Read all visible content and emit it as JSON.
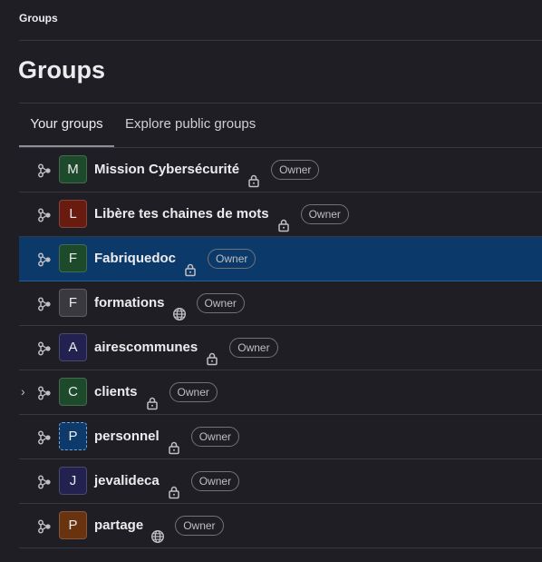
{
  "breadcrumb": "Groups",
  "page_title": "Groups",
  "tabs": [
    {
      "label": "Your groups",
      "active": true
    },
    {
      "label": "Explore public groups",
      "active": false
    }
  ],
  "groups": [
    {
      "initial": "M",
      "name": "Mission Cybersécurité",
      "visibility": "private",
      "role": "Owner",
      "avatar_color": "#1c4a2a",
      "expandable": false,
      "selected": false
    },
    {
      "initial": "L",
      "name": "Libère tes chaines de mots",
      "visibility": "private",
      "role": "Owner",
      "avatar_color": "#6a1b10",
      "expandable": false,
      "selected": false
    },
    {
      "initial": "F",
      "name": "Fabriquedoc",
      "visibility": "private",
      "role": "Owner",
      "avatar_color": "#1c4a2a",
      "expandable": false,
      "selected": true
    },
    {
      "initial": "F",
      "name": "formations",
      "visibility": "public",
      "role": "Owner",
      "avatar_color": "#3a393f",
      "expandable": false,
      "selected": false
    },
    {
      "initial": "A",
      "name": "airescommunes",
      "visibility": "private",
      "role": "Owner",
      "avatar_color": "#232150",
      "expandable": false,
      "selected": false
    },
    {
      "initial": "C",
      "name": "clients",
      "visibility": "private",
      "role": "Owner",
      "avatar_color": "#1c4a2a",
      "expandable": true,
      "selected": false
    },
    {
      "initial": "P",
      "name": "personnel",
      "visibility": "private",
      "role": "Owner",
      "avatar_color": "#0e3a6b",
      "expandable": false,
      "selected": false
    },
    {
      "initial": "J",
      "name": "jevalideca",
      "visibility": "private",
      "role": "Owner",
      "avatar_color": "#232150",
      "expandable": false,
      "selected": false
    },
    {
      "initial": "P",
      "name": "partage",
      "visibility": "public",
      "role": "Owner",
      "avatar_color": "#6a3310",
      "expandable": false,
      "selected": false
    }
  ]
}
